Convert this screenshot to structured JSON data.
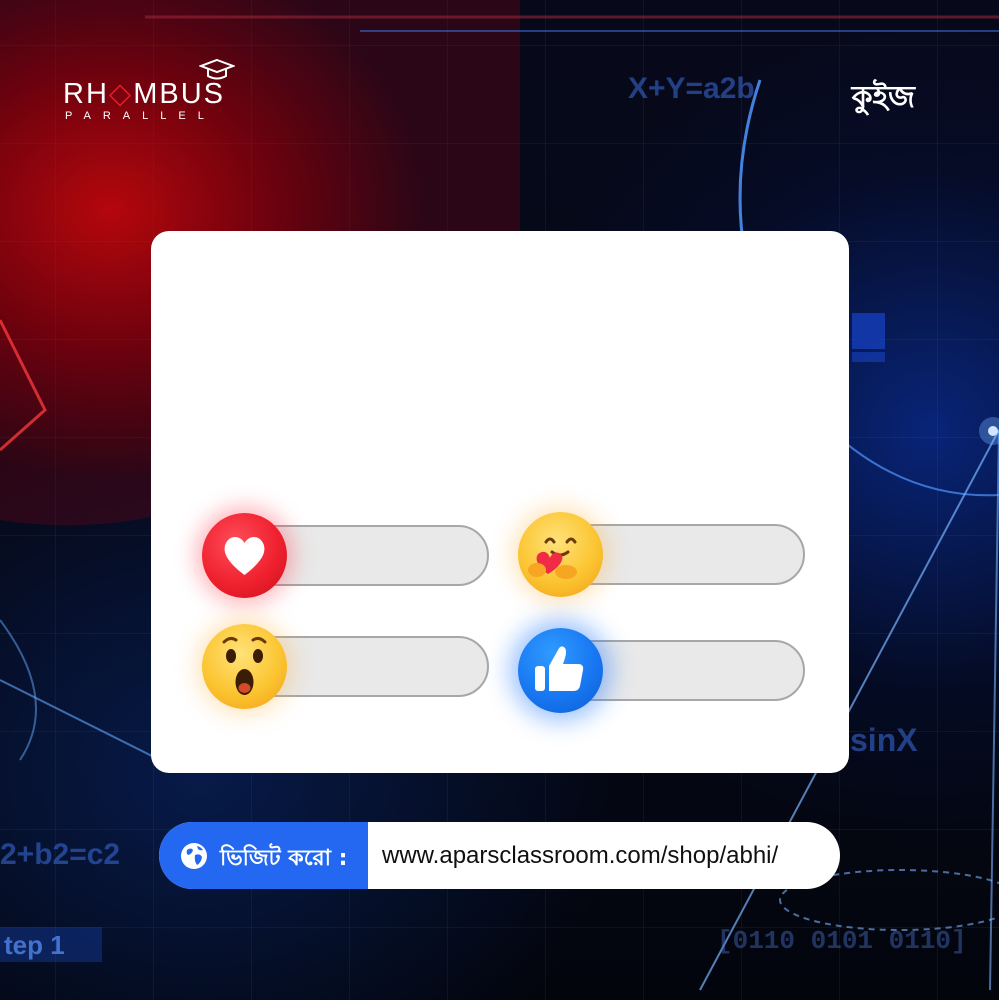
{
  "brand": {
    "name_pre": "RH",
    "name_post": "MBUS",
    "tagline": "PARALLEL",
    "accent": "#e11d2a"
  },
  "header": {
    "quiz_label": "কুইজ"
  },
  "background_text": {
    "formula_top": "X+Y=a2b",
    "formula_left": "2+b2=c2",
    "formula_right": "sinX",
    "step_label": "tep 1",
    "binary": "[0110 0101 0110]"
  },
  "quiz_card": {
    "options": [
      {
        "reaction": "love",
        "icon": "heart-icon",
        "color": "#f0212f"
      },
      {
        "reaction": "care",
        "icon": "hug-face-icon",
        "color": "#fbc531"
      },
      {
        "reaction": "wow",
        "icon": "surprised-face-icon",
        "color": "#fbc531"
      },
      {
        "reaction": "like",
        "icon": "thumbs-up-icon",
        "color": "#1877f2"
      }
    ]
  },
  "footer": {
    "visit_label": "ভিজিট করো :",
    "url": "www.aparsclassroom.com/shop/abhi/",
    "accent": "#2468f2"
  }
}
